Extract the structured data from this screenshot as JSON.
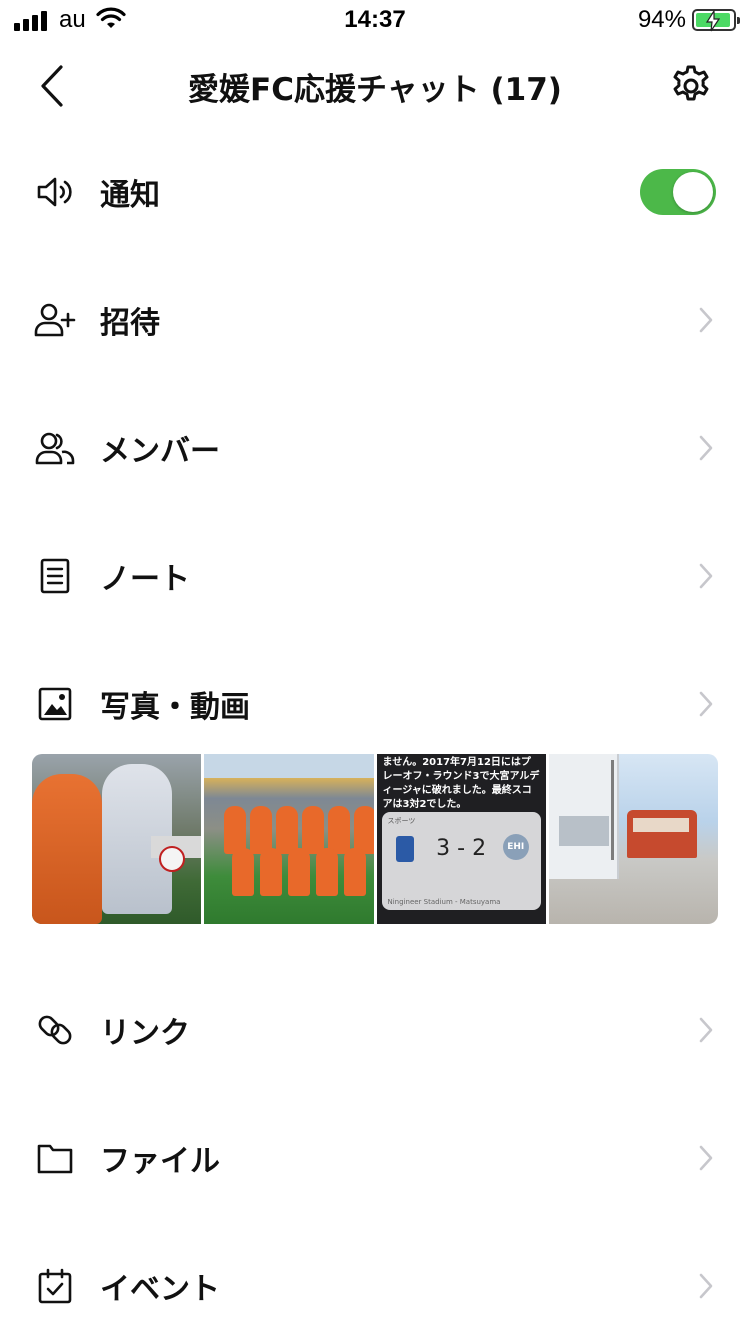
{
  "status_bar": {
    "carrier": "au",
    "time": "14:37",
    "battery_percent": "94%",
    "battery_level": 0.94,
    "charging": true
  },
  "header": {
    "title": "愛媛FC応援チャット (17)"
  },
  "menu": {
    "notifications": {
      "label": "通知",
      "toggle_on": true,
      "icon": "speaker-icon"
    },
    "invite": {
      "label": "招待",
      "icon": "add-person-icon"
    },
    "members": {
      "label": "メンバー",
      "icon": "people-icon"
    },
    "notes": {
      "label": "ノート",
      "icon": "document-icon"
    },
    "photos": {
      "label": "写真・動画",
      "icon": "image-icon"
    },
    "links": {
      "label": "リンク",
      "icon": "link-icon"
    },
    "files": {
      "label": "ファイル",
      "icon": "folder-icon"
    },
    "events": {
      "label": "イベント",
      "icon": "calendar-icon"
    }
  },
  "photo_strip": {
    "thumb3": {
      "text": "ません。2017年7月12日にはプレーオフ・ラウンド3で大宮アルディージャに破れました。最終スコアは3対2でした。",
      "card_category": "スポーツ",
      "score": "3 - 2",
      "right_team_abbr": "EHI",
      "footer": "Ningineer Stadium - Matsuyama"
    }
  },
  "colors": {
    "toggle_on": "#4cb849",
    "text": "#111111",
    "chevron": "#c7c7cc",
    "battery": "#4cd964"
  }
}
